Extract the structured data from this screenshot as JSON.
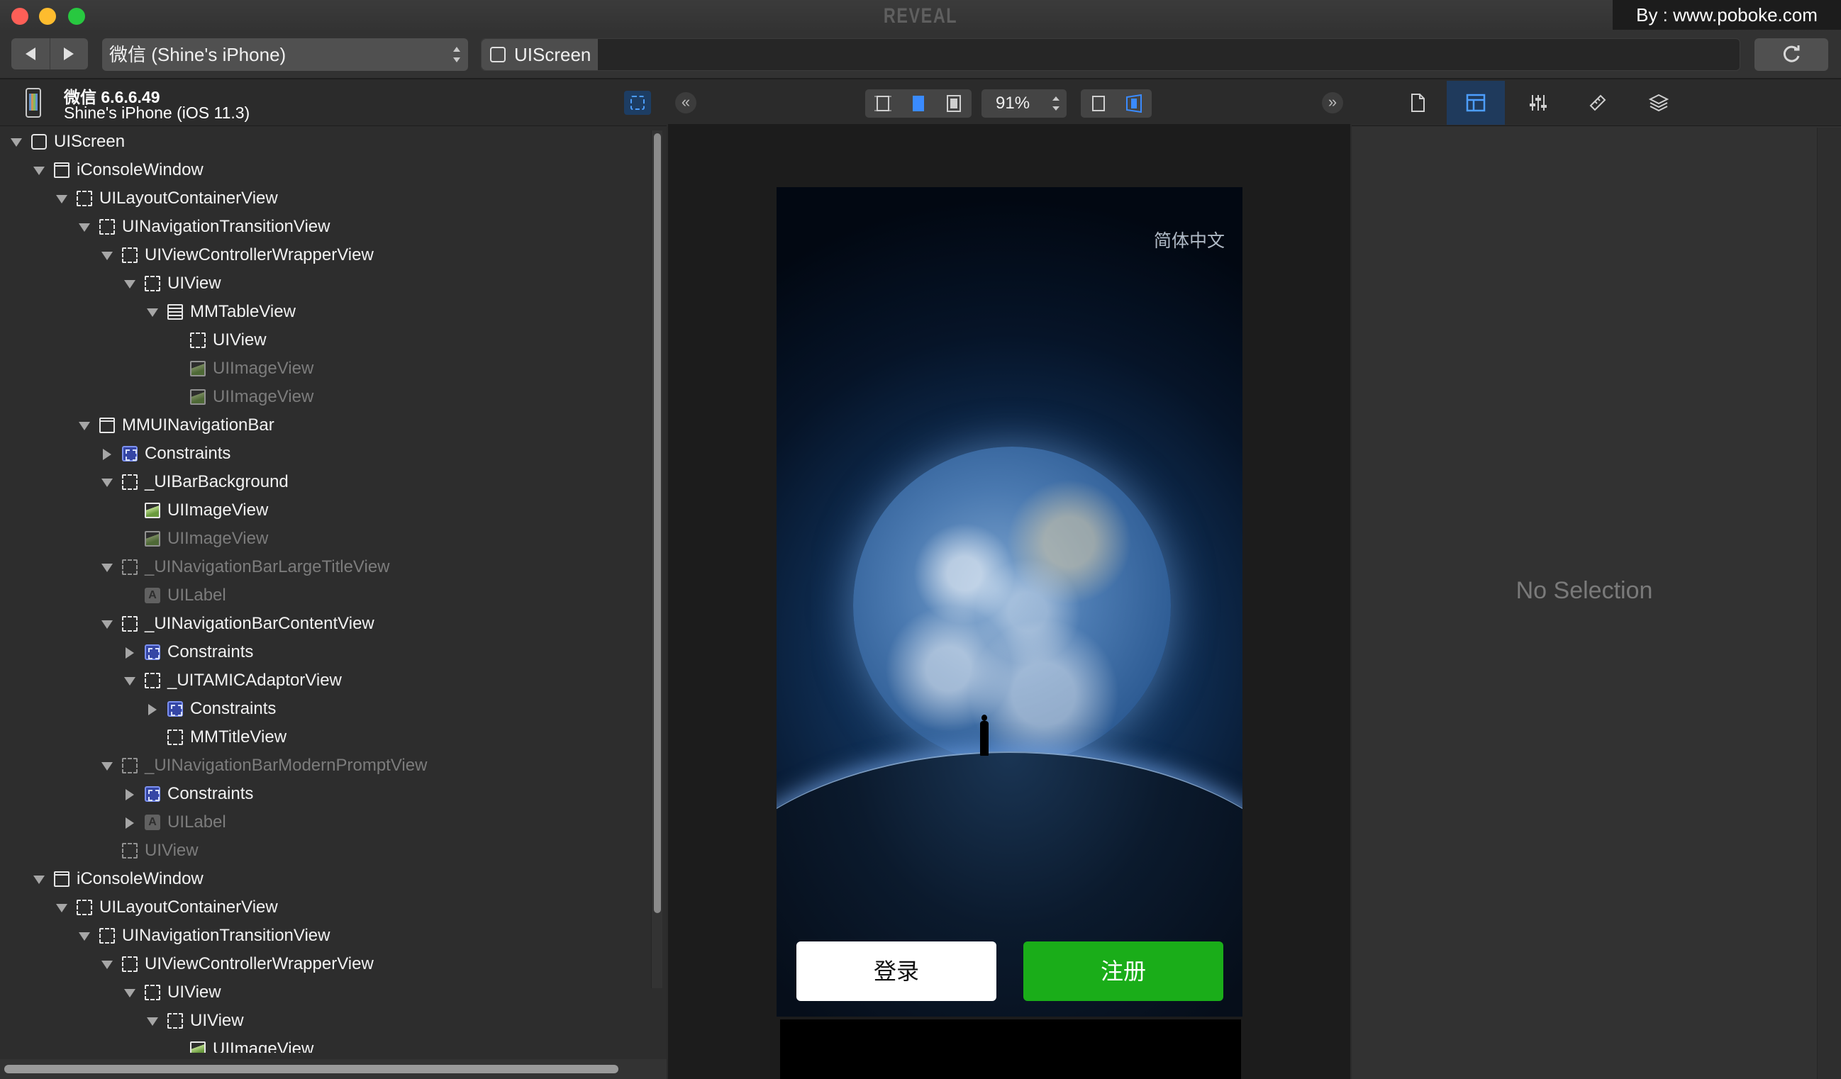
{
  "window": {
    "app_title": "REVEAL",
    "watermark": "By : www.poboke.com"
  },
  "toolbar": {
    "back_label": "◀",
    "forward_label": "▶",
    "device_selector": "微信 (Shine's iPhone)",
    "breadcrumb": [
      "UIScreen"
    ],
    "refresh_icon": "refresh-icon"
  },
  "device": {
    "app_name": "微信 6.6.6.49",
    "device_info": "Shine's iPhone (iOS 11.3)"
  },
  "tree": [
    {
      "label": "UIScreen",
      "depth": 0,
      "icon": "screen",
      "disclosure": "open",
      "dim": false
    },
    {
      "label": "iConsoleWindow",
      "depth": 1,
      "icon": "window",
      "disclosure": "open",
      "dim": false
    },
    {
      "label": "UILayoutContainerView",
      "depth": 2,
      "icon": "view",
      "disclosure": "open",
      "dim": false
    },
    {
      "label": "UINavigationTransitionView",
      "depth": 3,
      "icon": "view",
      "disclosure": "open",
      "dim": false
    },
    {
      "label": "UIViewControllerWrapperView",
      "depth": 4,
      "icon": "view",
      "disclosure": "open",
      "dim": false
    },
    {
      "label": "UIView",
      "depth": 5,
      "icon": "view",
      "disclosure": "open",
      "dim": false
    },
    {
      "label": "MMTableView",
      "depth": 6,
      "icon": "table",
      "disclosure": "open",
      "dim": false
    },
    {
      "label": "UIView",
      "depth": 7,
      "icon": "view",
      "disclosure": "none",
      "dim": false
    },
    {
      "label": "UIImageView",
      "depth": 7,
      "icon": "image",
      "disclosure": "none",
      "dim": true
    },
    {
      "label": "UIImageView",
      "depth": 7,
      "icon": "image",
      "disclosure": "none",
      "dim": true
    },
    {
      "label": "MMUINavigationBar",
      "depth": 3,
      "icon": "window",
      "disclosure": "open",
      "dim": false
    },
    {
      "label": "Constraints",
      "depth": 4,
      "icon": "constraints",
      "disclosure": "closed",
      "dim": false
    },
    {
      "label": "_UIBarBackground",
      "depth": 4,
      "icon": "view",
      "disclosure": "open",
      "dim": false
    },
    {
      "label": "UIImageView",
      "depth": 5,
      "icon": "image",
      "disclosure": "none",
      "dim": false
    },
    {
      "label": "UIImageView",
      "depth": 5,
      "icon": "image",
      "disclosure": "none",
      "dim": true
    },
    {
      "label": "_UINavigationBarLargeTitleView",
      "depth": 4,
      "icon": "view",
      "disclosure": "open",
      "dim": true
    },
    {
      "label": "UILabel",
      "depth": 5,
      "icon": "label",
      "disclosure": "none",
      "dim": true
    },
    {
      "label": "_UINavigationBarContentView",
      "depth": 4,
      "icon": "view",
      "disclosure": "open",
      "dim": false
    },
    {
      "label": "Constraints",
      "depth": 5,
      "icon": "constraints",
      "disclosure": "closed",
      "dim": false
    },
    {
      "label": "_UITAMICAdaptorView",
      "depth": 5,
      "icon": "view",
      "disclosure": "open",
      "dim": false
    },
    {
      "label": "Constraints",
      "depth": 6,
      "icon": "constraints",
      "disclosure": "closed",
      "dim": false
    },
    {
      "label": "MMTitleView",
      "depth": 6,
      "icon": "view",
      "disclosure": "none",
      "dim": false
    },
    {
      "label": "_UINavigationBarModernPromptView",
      "depth": 4,
      "icon": "view",
      "disclosure": "open",
      "dim": true
    },
    {
      "label": "Constraints",
      "depth": 5,
      "icon": "constraints",
      "disclosure": "closed",
      "dim": false
    },
    {
      "label": "UILabel",
      "depth": 5,
      "icon": "label",
      "disclosure": "closed",
      "dim": true
    },
    {
      "label": "UIView",
      "depth": 4,
      "icon": "view",
      "disclosure": "none",
      "dim": true
    },
    {
      "label": "iConsoleWindow",
      "depth": 1,
      "icon": "window",
      "disclosure": "open",
      "dim": false
    },
    {
      "label": "UILayoutContainerView",
      "depth": 2,
      "icon": "view",
      "disclosure": "open",
      "dim": false
    },
    {
      "label": "UINavigationTransitionView",
      "depth": 3,
      "icon": "view",
      "disclosure": "open",
      "dim": false
    },
    {
      "label": "UIViewControllerWrapperView",
      "depth": 4,
      "icon": "view",
      "disclosure": "open",
      "dim": false
    },
    {
      "label": "UIView",
      "depth": 5,
      "icon": "view",
      "disclosure": "open",
      "dim": false
    },
    {
      "label": "UIView",
      "depth": 6,
      "icon": "view",
      "disclosure": "open",
      "dim": false
    },
    {
      "label": "UIImageView",
      "depth": 7,
      "icon": "image",
      "disclosure": "none",
      "dim": false
    }
  ],
  "center": {
    "zoom": "91%",
    "collapse_left": "«",
    "collapse_right": "»"
  },
  "phone_screen": {
    "language_link": "简体中文",
    "login_button": "登录",
    "register_button": "注册",
    "colors": {
      "register": "#1aad19",
      "login": "#ffffff"
    }
  },
  "inspector": {
    "tabs": [
      "file-icon",
      "layout-icon",
      "sliders-icon",
      "ruler-icon",
      "layers-icon"
    ],
    "active_tab": "layout-icon",
    "empty_text": "No Selection"
  },
  "colors": {
    "accent": "#4d9eff",
    "background": "#2b2b2b"
  }
}
